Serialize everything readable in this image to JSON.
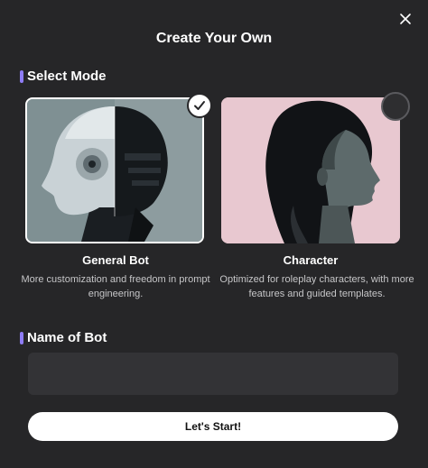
{
  "dialog": {
    "title": "Create Your Own",
    "close_icon": "close-icon"
  },
  "select_mode": {
    "label": "Select Mode",
    "selected": "General Bot",
    "options": [
      {
        "title": "General Bot",
        "description": "More customization and freedom in prompt engineering.",
        "image": "robot-head-profile-illustration",
        "selected": true
      },
      {
        "title": "Character",
        "description": "Optimized for roleplay characters, with more features and guided templates.",
        "image": "woman-profile-illustration",
        "selected": false
      }
    ]
  },
  "name_of_bot": {
    "label": "Name of Bot",
    "value": "",
    "placeholder": ""
  },
  "start_button": {
    "label": "Let's Start!"
  },
  "colors": {
    "background": "#262628",
    "accent": "#8e7cf5",
    "input_bg": "#333336",
    "button_bg": "#ffffff"
  }
}
